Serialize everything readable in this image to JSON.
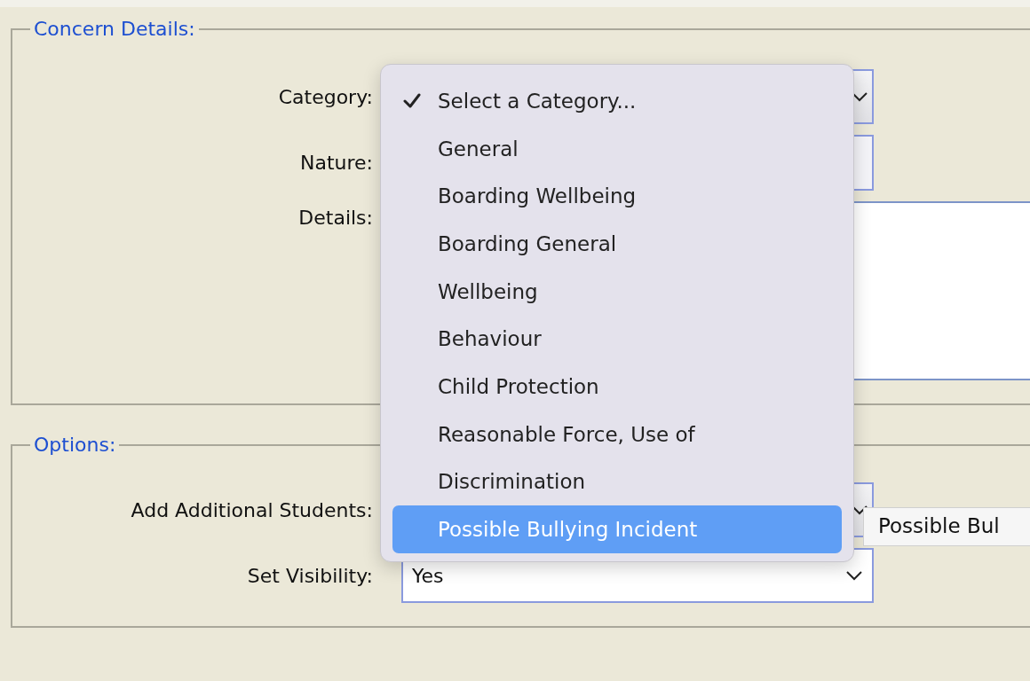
{
  "sections": [
    {
      "legend": "Concern Details:",
      "fields": [
        {
          "label": "Category:",
          "kind": "select"
        },
        {
          "label": "Nature:",
          "kind": "input"
        },
        {
          "label": "Details:",
          "kind": "textarea"
        }
      ]
    },
    {
      "legend": "Options:",
      "fields": [
        {
          "label": "Add Additional Students:",
          "kind": "select"
        },
        {
          "label": "Set Visibility:",
          "kind": "select",
          "value": "Yes"
        }
      ]
    }
  ],
  "dropdown": {
    "items": [
      {
        "label": "Select a Category...",
        "checked": true,
        "selected": false
      },
      {
        "label": "General",
        "checked": false,
        "selected": false
      },
      {
        "label": "Boarding Wellbeing",
        "checked": false,
        "selected": false
      },
      {
        "label": "Boarding General",
        "checked": false,
        "selected": false
      },
      {
        "label": "Wellbeing",
        "checked": false,
        "selected": false
      },
      {
        "label": "Behaviour",
        "checked": false,
        "selected": false
      },
      {
        "label": "Child Protection",
        "checked": false,
        "selected": false
      },
      {
        "label": "Reasonable Force, Use of",
        "checked": false,
        "selected": false
      },
      {
        "label": "Discrimination",
        "checked": false,
        "selected": false
      },
      {
        "label": "Possible Bullying Incident",
        "checked": false,
        "selected": true
      }
    ]
  },
  "tooltip": {
    "text": "Possible Bul"
  }
}
